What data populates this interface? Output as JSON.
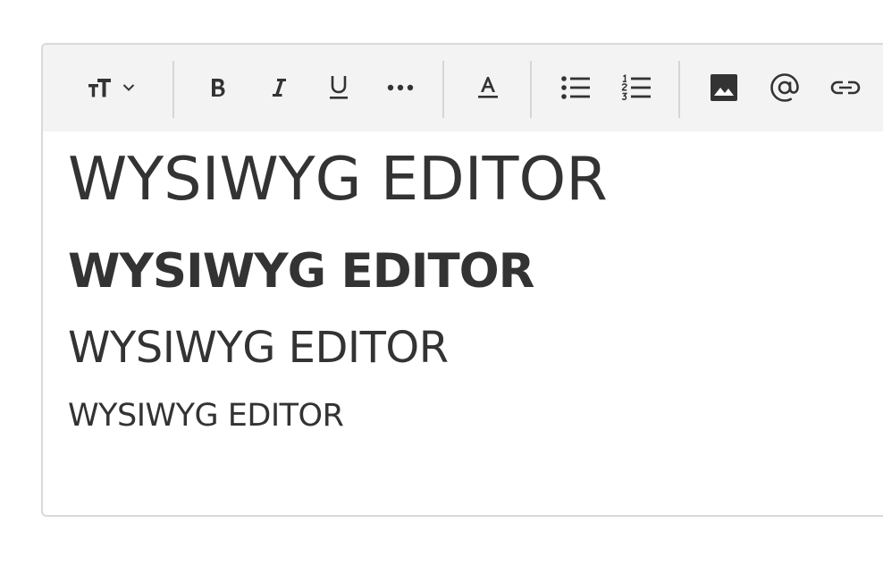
{
  "toolbar": {
    "buttons": [
      {
        "name": "text-size",
        "icon": "text-size-icon"
      },
      {
        "name": "bold",
        "icon": "bold-icon",
        "glyph": "B"
      },
      {
        "name": "italic",
        "icon": "italic-icon"
      },
      {
        "name": "underline",
        "icon": "underline-icon"
      },
      {
        "name": "more",
        "icon": "more-horizontal-icon"
      },
      {
        "name": "text-color",
        "icon": "text-color-icon"
      },
      {
        "name": "bulleted-list",
        "icon": "bulleted-list-icon"
      },
      {
        "name": "numbered-list",
        "icon": "numbered-list-icon"
      },
      {
        "name": "insert-image",
        "icon": "image-icon"
      },
      {
        "name": "mention",
        "icon": "at-sign-icon"
      },
      {
        "name": "insert-link",
        "icon": "link-icon"
      }
    ]
  },
  "content": {
    "lines": [
      "WYSIWYG EDITOR",
      "WYSIWYG EDITOR",
      "WYSIWYG EDITOR",
      "WYSIWYG EDITOR"
    ]
  },
  "colors": {
    "toolbar_bg": "#f3f3f3",
    "text": "#333333",
    "border": "#d9d9d9",
    "separator": "#d6d6d6"
  }
}
